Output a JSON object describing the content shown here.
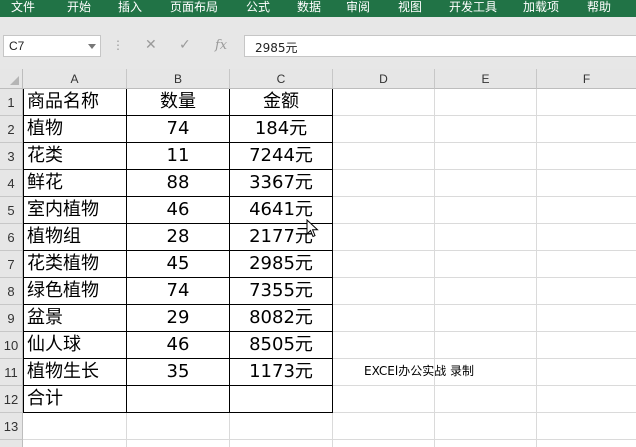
{
  "ribbon": {
    "tabs": [
      "文件",
      "开始",
      "插入",
      "页面布局",
      "公式",
      "数据",
      "审阅",
      "视图",
      "开发工具",
      "加载项",
      "帮助"
    ]
  },
  "formula_bar": {
    "name_box": "C7",
    "formula_value": "2985元",
    "fx_label": "fx"
  },
  "sheet": {
    "columns": [
      "A",
      "B",
      "C",
      "D",
      "E",
      "F"
    ],
    "rows": [
      "1",
      "2",
      "3",
      "4",
      "5",
      "6",
      "7",
      "8",
      "9",
      "10",
      "11",
      "12",
      "13"
    ],
    "table": [
      [
        "商品名称",
        "数量",
        "金额"
      ],
      [
        "植物",
        "74",
        "184元"
      ],
      [
        "花类",
        "11",
        "7244元"
      ],
      [
        "鲜花",
        "88",
        "3367元"
      ],
      [
        "室内植物",
        "46",
        "4641元"
      ],
      [
        "植物组",
        "28",
        "2177元"
      ],
      [
        "花类植物",
        "45",
        "2985元"
      ],
      [
        "绿色植物",
        "74",
        "7355元"
      ],
      [
        "盆景",
        "29",
        "8082元"
      ],
      [
        "仙人球",
        "46",
        "8505元"
      ],
      [
        "植物生长",
        "35",
        "1173元"
      ],
      [
        "合计",
        "",
        ""
      ]
    ],
    "watermark_note": "EXCEl办公实战 录制"
  },
  "colors": {
    "ribbon": "#217346",
    "grid_line": "#dadada",
    "header_bg": "#e6e6e6"
  }
}
